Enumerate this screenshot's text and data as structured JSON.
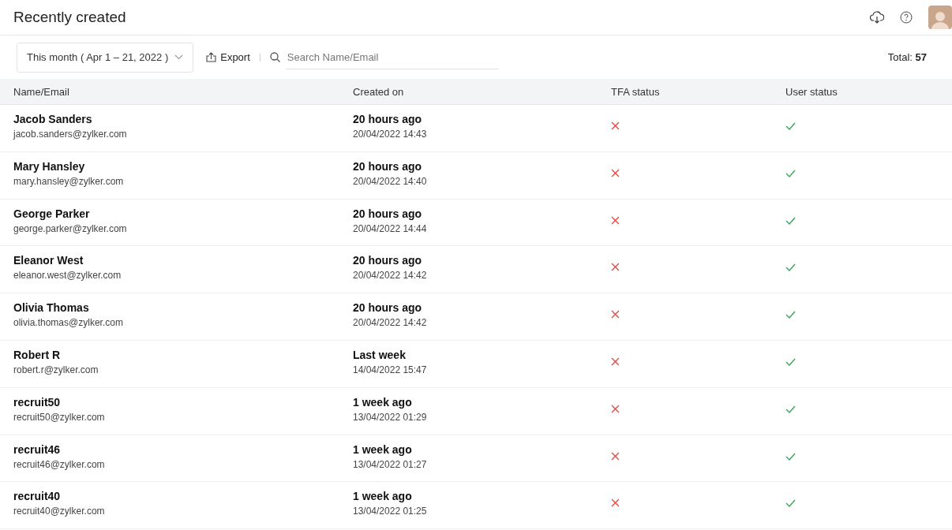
{
  "header": {
    "title": "Recently created"
  },
  "toolbar": {
    "period": "This month ( Apr 1 – 21, 2022 )",
    "export": "Export",
    "search": {
      "placeholder": "Search Name/Email"
    },
    "total_label": "Total:",
    "total": "57"
  },
  "table": {
    "columns": [
      "Name/Email",
      "Created on",
      "TFA status",
      "User status"
    ],
    "rows": [
      {
        "name": "Jacob Sanders",
        "email": "jacob.sanders@zylker.com",
        "created": "20 hours ago",
        "date": "20/04/2022 14:43",
        "tfa": false,
        "active": true
      },
      {
        "name": "Mary Hansley",
        "email": "mary.hansley@zylker.com",
        "created": "20 hours ago",
        "date": "20/04/2022 14:40",
        "tfa": false,
        "active": true
      },
      {
        "name": "George Parker",
        "email": "george.parker@zylker.com",
        "created": "20 hours ago",
        "date": "20/04/2022 14:44",
        "tfa": false,
        "active": true
      },
      {
        "name": "Eleanor West",
        "email": "eleanor.west@zylker.com",
        "created": "20 hours ago",
        "date": "20/04/2022 14:42",
        "tfa": false,
        "active": true
      },
      {
        "name": "Olivia Thomas",
        "email": "olivia.thomas@zylker.com",
        "created": "20 hours ago",
        "date": "20/04/2022 14:42",
        "tfa": false,
        "active": true
      },
      {
        "name": "Robert R",
        "email": "robert.r@zylker.com",
        "created": "Last week",
        "date": "14/04/2022 15:47",
        "tfa": false,
        "active": true
      },
      {
        "name": "recruit50",
        "email": "recruit50@zylker.com",
        "created": "1 week ago",
        "date": "13/04/2022 01:29",
        "tfa": false,
        "active": true
      },
      {
        "name": "recruit46",
        "email": "recruit46@zylker.com",
        "created": "1 week ago",
        "date": "13/04/2022 01:27",
        "tfa": false,
        "active": true
      },
      {
        "name": "recruit40",
        "email": "recruit40@zylker.com",
        "created": "1 week ago",
        "date": "13/04/2022 01:25",
        "tfa": false,
        "active": true
      }
    ]
  }
}
